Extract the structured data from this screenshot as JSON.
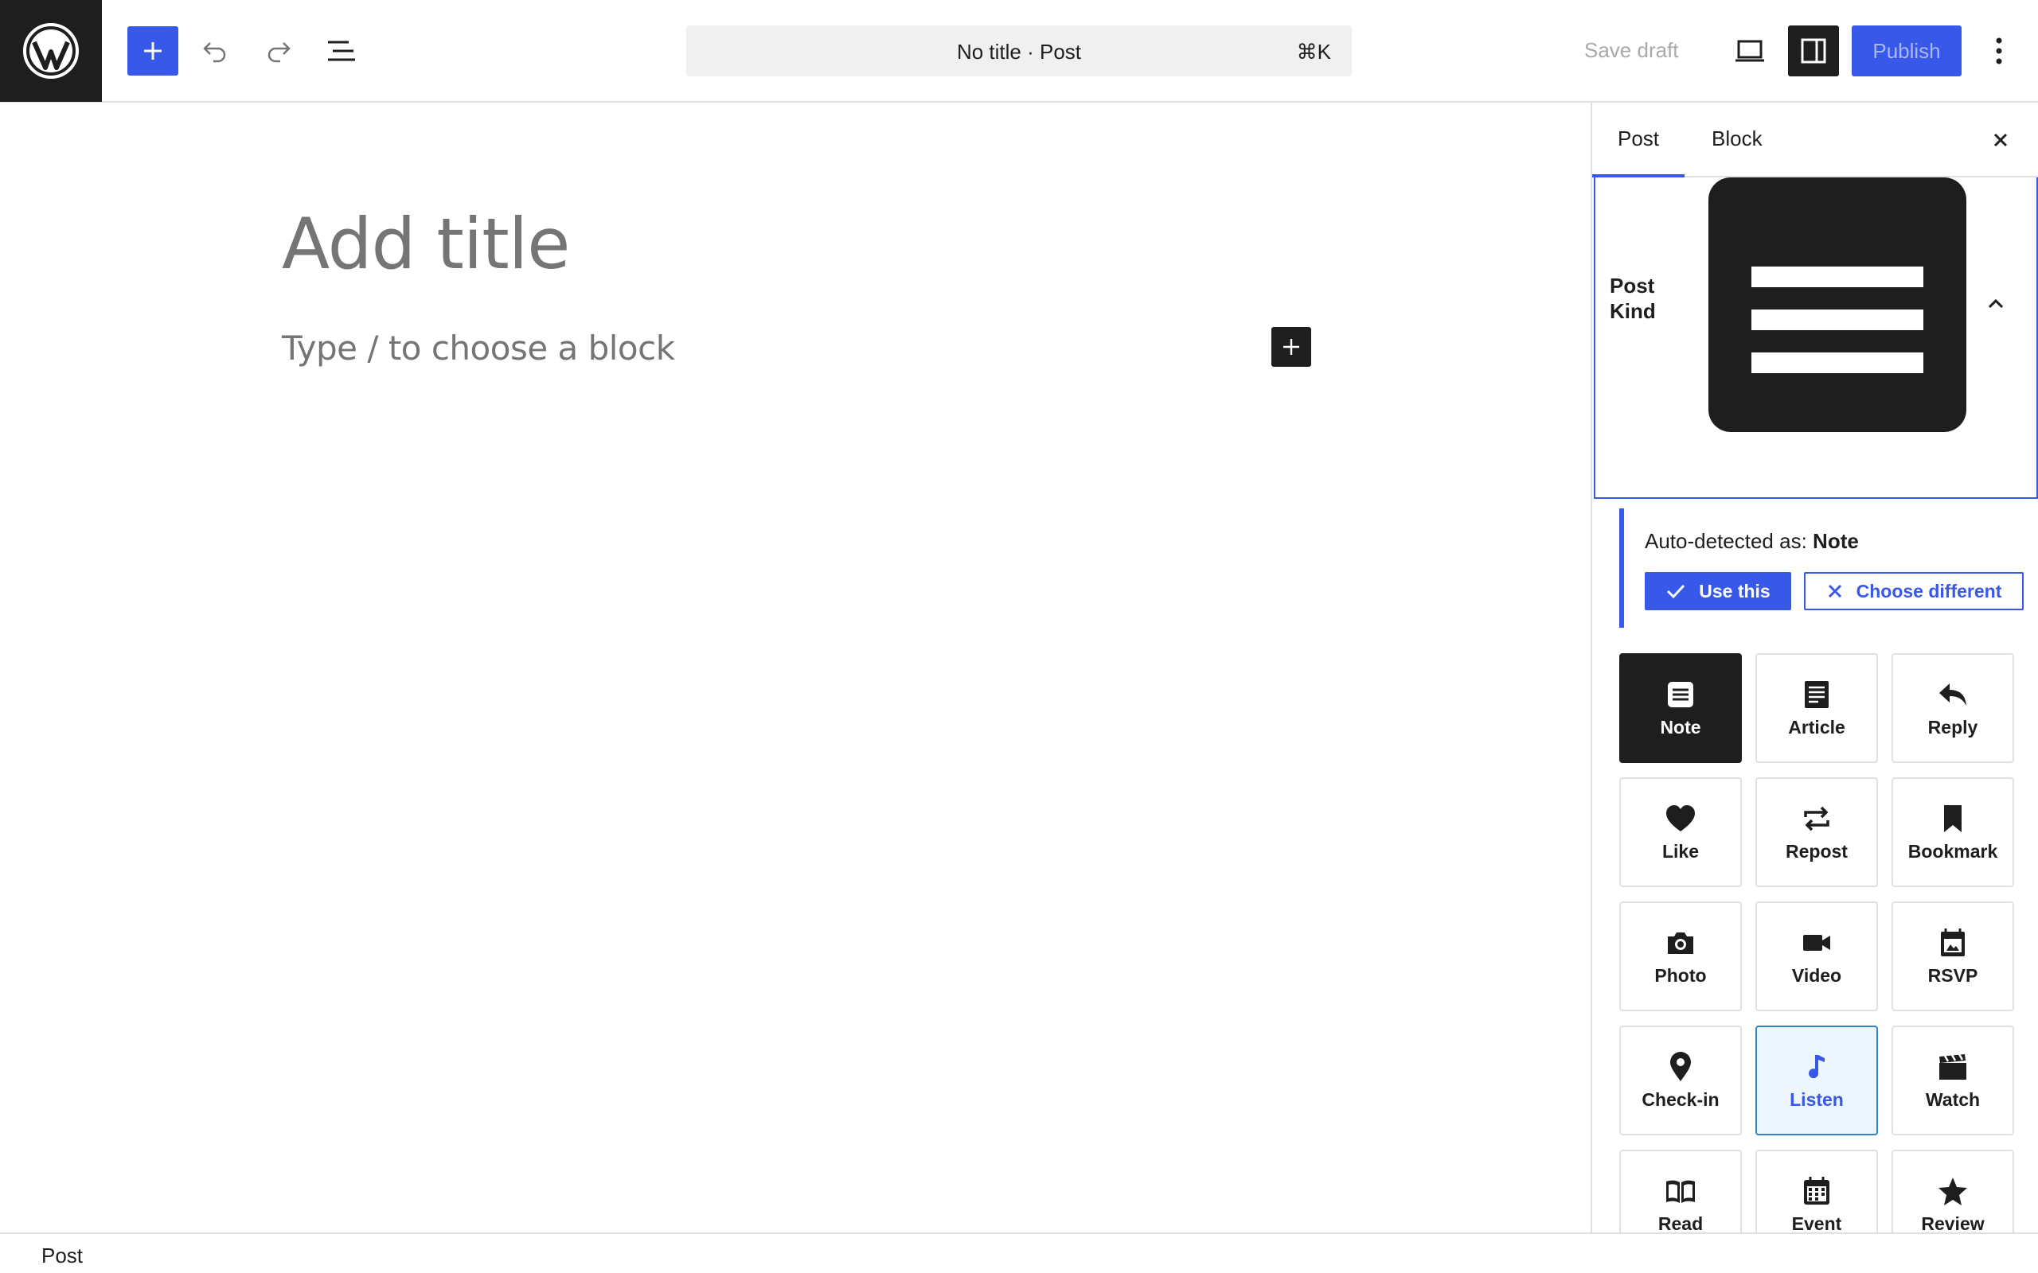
{
  "header": {
    "command_title": "No title · Post",
    "command_shortcut": "⌘K",
    "save_draft": "Save draft",
    "publish": "Publish"
  },
  "editor": {
    "title_placeholder": "Add title",
    "block_placeholder": "Type / to choose a block"
  },
  "sidebar": {
    "tabs": [
      "Post",
      "Block"
    ],
    "active_tab": "Post",
    "panel_label": "Post Kind",
    "auto_detected_prefix": "Auto-detected as:",
    "auto_detected_value": "Note",
    "use_this": "Use this",
    "choose_different": "Choose different",
    "kinds": [
      {
        "label": "Note",
        "icon": "note-icon",
        "state": "selected"
      },
      {
        "label": "Article",
        "icon": "article-icon",
        "state": ""
      },
      {
        "label": "Reply",
        "icon": "reply-icon",
        "state": ""
      },
      {
        "label": "Like",
        "icon": "heart-icon",
        "state": ""
      },
      {
        "label": "Repost",
        "icon": "repost-icon",
        "state": ""
      },
      {
        "label": "Bookmark",
        "icon": "bookmark-icon",
        "state": ""
      },
      {
        "label": "Photo",
        "icon": "camera-icon",
        "state": ""
      },
      {
        "label": "Video",
        "icon": "video-icon",
        "state": ""
      },
      {
        "label": "RSVP",
        "icon": "rsvp-icon",
        "state": ""
      },
      {
        "label": "Check-in",
        "icon": "location-pin-icon",
        "state": ""
      },
      {
        "label": "Listen",
        "icon": "music-note-icon",
        "state": "highlighted"
      },
      {
        "label": "Watch",
        "icon": "clapperboard-icon",
        "state": ""
      },
      {
        "label": "Read",
        "icon": "book-icon",
        "state": ""
      },
      {
        "label": "Event",
        "icon": "calendar-icon",
        "state": ""
      },
      {
        "label": "Review",
        "icon": "star-icon",
        "state": ""
      }
    ]
  },
  "footer": {
    "breadcrumb": "Post"
  },
  "colors": {
    "accent": "#3858e9",
    "dark": "#1e1e1e",
    "highlight_bg": "#eef6fd"
  }
}
